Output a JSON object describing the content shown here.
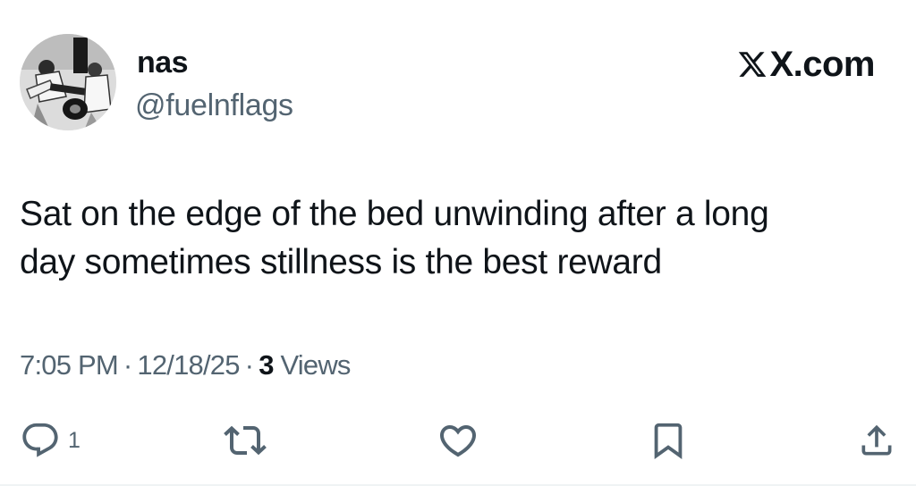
{
  "author": {
    "display_name": "nas",
    "handle": "@fuelnflags",
    "avatar_icon": "avatar-photo"
  },
  "brand": {
    "text": "X.com",
    "icon": "x-logo-icon"
  },
  "tweet": {
    "text_line1": "Sat on the edge of the bed unwinding after a long",
    "text_line2": "day sometimes stillness is the best reward"
  },
  "meta": {
    "time": "7:05 PM",
    "separator": "·",
    "date": "12/18/25",
    "views_count": "3",
    "views_label": "Views"
  },
  "actions": {
    "reply_count": "1",
    "reply_icon": "reply-icon",
    "retweet_icon": "retweet-icon",
    "like_icon": "heart-icon",
    "bookmark_icon": "bookmark-icon",
    "share_icon": "share-icon"
  },
  "colors": {
    "text_primary": "#0f1419",
    "text_secondary": "#536471",
    "icon": "#536471",
    "divider": "#eff3f4"
  }
}
